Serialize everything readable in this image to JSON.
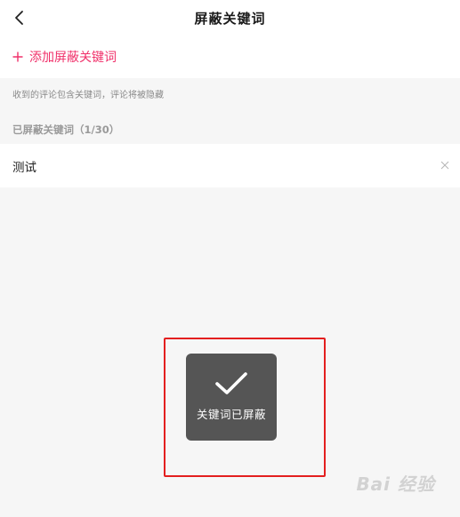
{
  "header": {
    "title": "屏蔽关键词",
    "back_icon": "chevron-left-icon"
  },
  "add_keyword": {
    "label": "添加屏蔽关键词",
    "icon": "plus-icon",
    "accent_color": "#f0306a"
  },
  "hint": "收到的评论包含关键词，评论将被隐藏",
  "blocked_section": {
    "title": "已屏蔽关键词（1/30）",
    "items": [
      {
        "keyword": "测试",
        "remove_icon": "close-icon"
      }
    ]
  },
  "toast": {
    "icon": "checkmark-icon",
    "message": "关键词已屏蔽"
  },
  "annotation_color": "#e31f1f",
  "watermark": "Bai 经验"
}
